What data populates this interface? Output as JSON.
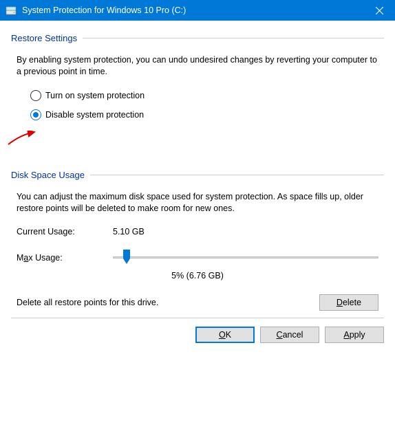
{
  "titlebar": {
    "title": "System Protection for Windows 10 Pro (C:)"
  },
  "restore": {
    "heading": "Restore Settings",
    "description": "By enabling system protection, you can undo undesired changes by reverting your computer to a previous point in time.",
    "option_on": "Turn on system protection",
    "option_off": "Disable system protection",
    "selected": "off"
  },
  "disk": {
    "heading": "Disk Space Usage",
    "description": "You can adjust the maximum disk space used for system protection. As space fills up, older restore points will be deleted to make room for new ones.",
    "current_label": "Current Usage:",
    "current_value": "5.10 GB",
    "max_label_pre": "M",
    "max_label_underline": "a",
    "max_label_post": "x Usage:",
    "slider_percent": 5,
    "slider_display": "5% (6.76 GB)"
  },
  "delete": {
    "text": "Delete all restore points for this drive.",
    "button_pre": "",
    "button_underline": "D",
    "button_post": "elete"
  },
  "footer": {
    "ok_pre": "",
    "ok_underline": "O",
    "ok_post": "K",
    "cancel_pre": "",
    "cancel_underline": "C",
    "cancel_post": "ancel",
    "apply_pre": "",
    "apply_underline": "A",
    "apply_post": "pply"
  }
}
